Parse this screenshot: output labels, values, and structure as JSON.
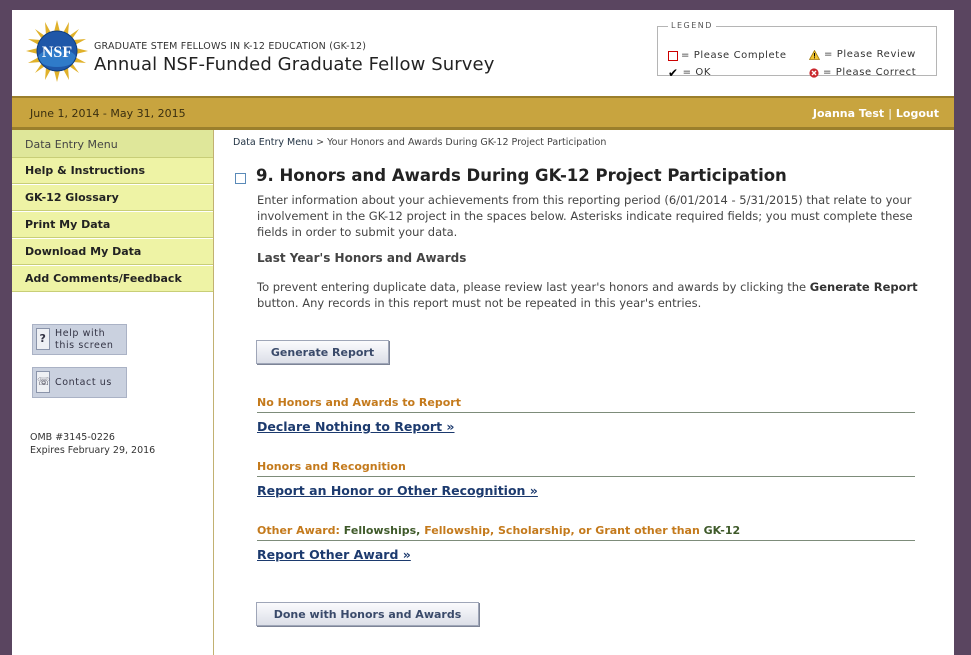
{
  "header": {
    "logo_text": "NSF",
    "subtitle": "GRADUATE STEM FELLOWS IN K-12 EDUCATION (GK-12)",
    "title": "Annual NSF-Funded Graduate Fellow Survey"
  },
  "legend": {
    "title": "LEGEND",
    "please_complete": "= Please Complete",
    "please_review": "= Please Review",
    "ok": "= OK",
    "please_correct": "= Please Correct"
  },
  "topbar": {
    "period": "June 1, 2014 - May 31, 2015",
    "user": "Joanna Test",
    "separator": "|",
    "logout": "Logout"
  },
  "sidebar": {
    "menu": [
      {
        "label": "Data Entry Menu"
      },
      {
        "label": "Help & Instructions"
      },
      {
        "label": "GK-12 Glossary"
      },
      {
        "label": "Print My Data"
      },
      {
        "label": "Download My Data"
      },
      {
        "label": "Add Comments/Feedback"
      }
    ],
    "help_line1": "Help with",
    "help_line2": "this screen",
    "contact": "Contact us",
    "omb": "OMB #3145-0226",
    "expires": "Expires February 29, 2016"
  },
  "breadcrumb": {
    "root": "Data Entry Menu",
    "sep": ">",
    "current": "Your Honors and Awards During GK-12 Project Participation"
  },
  "main": {
    "heading": "9. Honors and Awards During GK-12 Project Participation",
    "intro": "Enter information about your achievements from this reporting period (6/01/2014 - 5/31/2015) that relate to your involvement in the GK-12 project in the spaces below. Asterisks indicate required fields; you must complete these fields in order to submit your data.",
    "last_year_heading": "Last Year's Honors and Awards",
    "prevent_before": "To prevent entering duplicate data, please review last year's honors and awards by clicking the",
    "prevent_bold": "Generate Report",
    "prevent_after": "button. Any records in this report must not be repeated in this year's entries.",
    "generate_button": "Generate Report",
    "sections": [
      {
        "title": "No Honors and Awards to Report",
        "link": "Declare Nothing to Report »"
      },
      {
        "title": "Honors and Recognition",
        "link": "Report an Honor or Other Recognition »"
      },
      {
        "title_a": "Other Award:",
        "title_b": "Fellowships,",
        "title_c": "Fellowship, Scholarship, or Grant other than",
        "title_d": "GK-12",
        "link": "Report Other Award »"
      }
    ],
    "done_button": "Done with Honors and Awards"
  }
}
